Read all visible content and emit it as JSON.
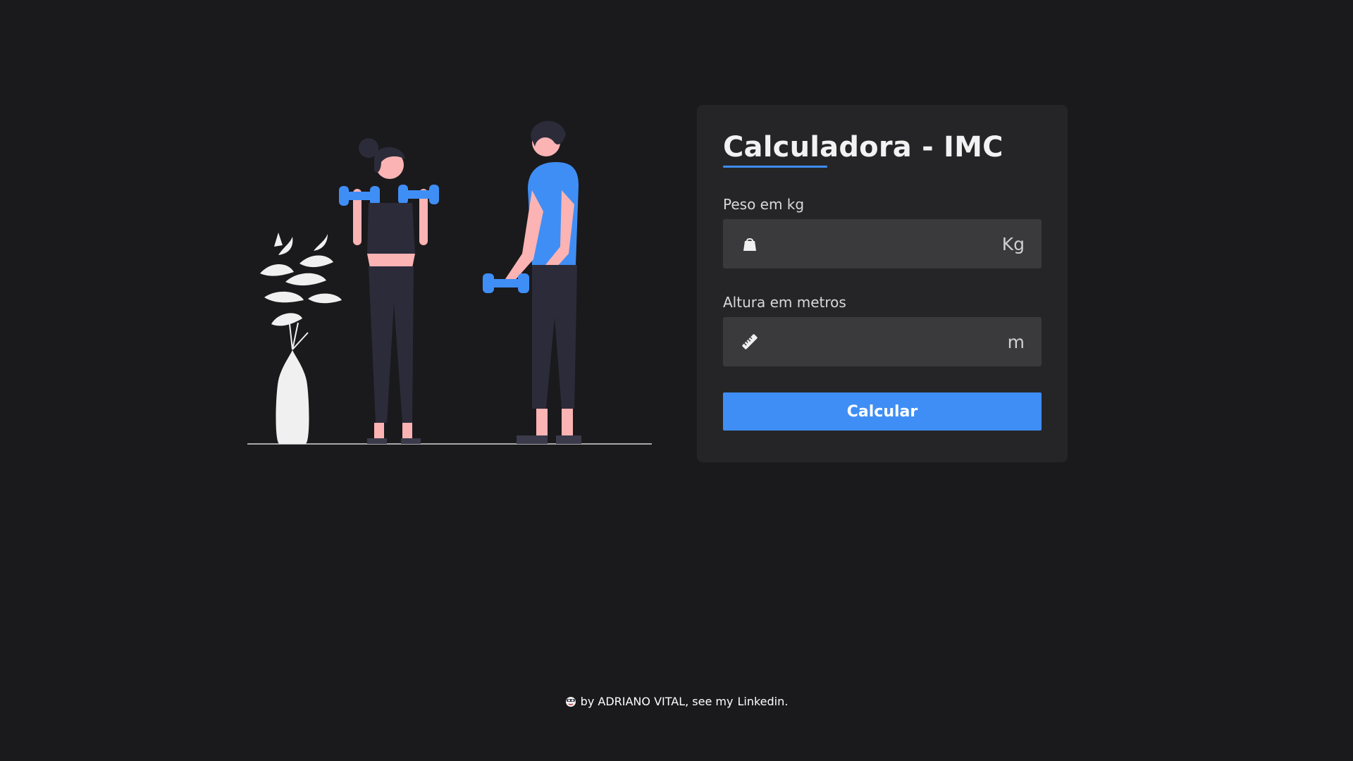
{
  "card": {
    "title": "Calculadora - IMC",
    "weight_label": "Peso em kg",
    "weight_value": "",
    "weight_unit": "Kg",
    "height_label": "Altura em metros",
    "height_value": "",
    "height_unit": "m",
    "button_label": "Calcular"
  },
  "footer": {
    "prefix": "by ADRIANO VITAL, see my",
    "link_text": "Linkedin."
  },
  "colors": {
    "background": "#1a1a1c",
    "card": "#252527",
    "input": "#3a3a3d",
    "accent": "#3f8ef5"
  },
  "icons": {
    "weight": "weight-icon",
    "height": "ruler-icon",
    "footer": "emoji-face-icon"
  }
}
